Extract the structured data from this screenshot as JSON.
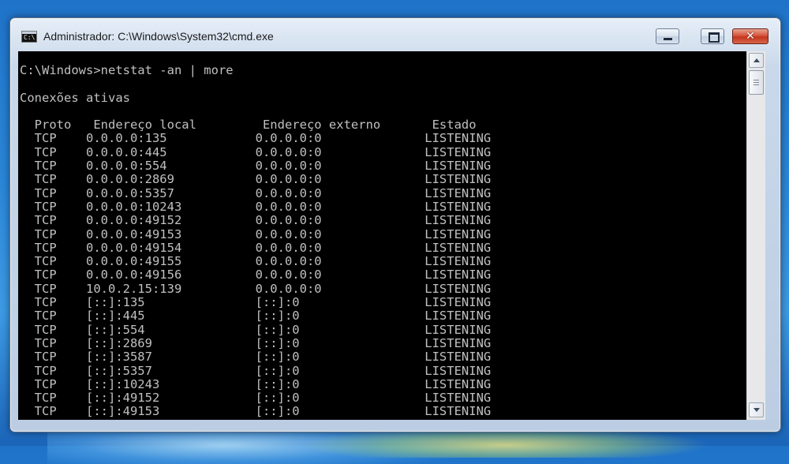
{
  "window": {
    "title": "Administrador: C:\\Windows\\System32\\cmd.exe",
    "icon": "cmd-icon",
    "controls": {
      "minimize": "minimize-icon",
      "maximize": "maximize-icon",
      "close": "✕"
    }
  },
  "console": {
    "prompt_line": "C:\\Windows>netstat -an | more",
    "section_title": "Conexões ativas",
    "header": {
      "proto": "Proto",
      "local": "Endereço local",
      "remote": "Endereço externo",
      "state": "Estado"
    },
    "rows": [
      {
        "proto": "TCP",
        "local": "0.0.0.0:135",
        "remote": "0.0.0.0:0",
        "state": "LISTENING"
      },
      {
        "proto": "TCP",
        "local": "0.0.0.0:445",
        "remote": "0.0.0.0:0",
        "state": "LISTENING"
      },
      {
        "proto": "TCP",
        "local": "0.0.0.0:554",
        "remote": "0.0.0.0:0",
        "state": "LISTENING"
      },
      {
        "proto": "TCP",
        "local": "0.0.0.0:2869",
        "remote": "0.0.0.0:0",
        "state": "LISTENING"
      },
      {
        "proto": "TCP",
        "local": "0.0.0.0:5357",
        "remote": "0.0.0.0:0",
        "state": "LISTENING"
      },
      {
        "proto": "TCP",
        "local": "0.0.0.0:10243",
        "remote": "0.0.0.0:0",
        "state": "LISTENING"
      },
      {
        "proto": "TCP",
        "local": "0.0.0.0:49152",
        "remote": "0.0.0.0:0",
        "state": "LISTENING"
      },
      {
        "proto": "TCP",
        "local": "0.0.0.0:49153",
        "remote": "0.0.0.0:0",
        "state": "LISTENING"
      },
      {
        "proto": "TCP",
        "local": "0.0.0.0:49154",
        "remote": "0.0.0.0:0",
        "state": "LISTENING"
      },
      {
        "proto": "TCP",
        "local": "0.0.0.0:49155",
        "remote": "0.0.0.0:0",
        "state": "LISTENING"
      },
      {
        "proto": "TCP",
        "local": "0.0.0.0:49156",
        "remote": "0.0.0.0:0",
        "state": "LISTENING"
      },
      {
        "proto": "TCP",
        "local": "10.0.2.15:139",
        "remote": "0.0.0.0:0",
        "state": "LISTENING"
      },
      {
        "proto": "TCP",
        "local": "[::]:135",
        "remote": "[::]:0",
        "state": "LISTENING"
      },
      {
        "proto": "TCP",
        "local": "[::]:445",
        "remote": "[::]:0",
        "state": "LISTENING"
      },
      {
        "proto": "TCP",
        "local": "[::]:554",
        "remote": "[::]:0",
        "state": "LISTENING"
      },
      {
        "proto": "TCP",
        "local": "[::]:2869",
        "remote": "[::]:0",
        "state": "LISTENING"
      },
      {
        "proto": "TCP",
        "local": "[::]:3587",
        "remote": "[::]:0",
        "state": "LISTENING"
      },
      {
        "proto": "TCP",
        "local": "[::]:5357",
        "remote": "[::]:0",
        "state": "LISTENING"
      },
      {
        "proto": "TCP",
        "local": "[::]:10243",
        "remote": "[::]:0",
        "state": "LISTENING"
      },
      {
        "proto": "TCP",
        "local": "[::]:49152",
        "remote": "[::]:0",
        "state": "LISTENING"
      },
      {
        "proto": "TCP",
        "local": "[::]:49153",
        "remote": "[::]:0",
        "state": "LISTENING"
      }
    ]
  },
  "scrollbar": {
    "up": "scroll-up-arrow-icon",
    "down": "scroll-down-arrow-icon"
  },
  "colors": {
    "console_bg": "#000000",
    "console_text": "#c0c0c0",
    "close_button": "#c2361d"
  }
}
